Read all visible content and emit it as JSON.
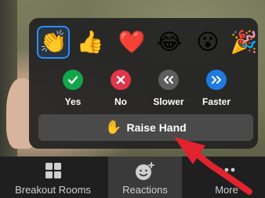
{
  "reactions": {
    "emojis": [
      {
        "name": "clapping-hands-emoji",
        "glyph": "👏",
        "selected": true
      },
      {
        "name": "thumbs-up-emoji",
        "glyph": "👍",
        "selected": false
      },
      {
        "name": "red-heart-emoji",
        "glyph": "❤️",
        "selected": false
      },
      {
        "name": "tears-of-joy-emoji",
        "glyph": "😂",
        "selected": false
      },
      {
        "name": "open-mouth-emoji",
        "glyph": "😮",
        "selected": false
      },
      {
        "name": "party-popper-emoji",
        "glyph": "🎉",
        "selected": false
      }
    ],
    "actions": [
      {
        "label": "Yes",
        "icon": "check-icon",
        "color": "#13a54c"
      },
      {
        "label": "No",
        "icon": "x-icon",
        "color": "#e0354a"
      },
      {
        "label": "Slower",
        "icon": "double-chevron-left-icon",
        "color": "#5e5e5e"
      },
      {
        "label": "Faster",
        "icon": "double-chevron-right-icon",
        "color": "#1f7ae0"
      }
    ],
    "raise_hand": {
      "label": "Raise Hand",
      "icon": "raised-hand-icon",
      "glyph": "✋"
    }
  },
  "toolbar": {
    "items": [
      {
        "label": "Breakout Rooms",
        "icon": "grid-icon",
        "active": false
      },
      {
        "label": "Reactions",
        "icon": "smiley-plus-icon",
        "active": true
      },
      {
        "label": "More",
        "icon": "ellipsis-icon",
        "active": false
      }
    ]
  },
  "colors": {
    "selected_border": "#2d8cff",
    "annotation_arrow": "#e0232f"
  }
}
